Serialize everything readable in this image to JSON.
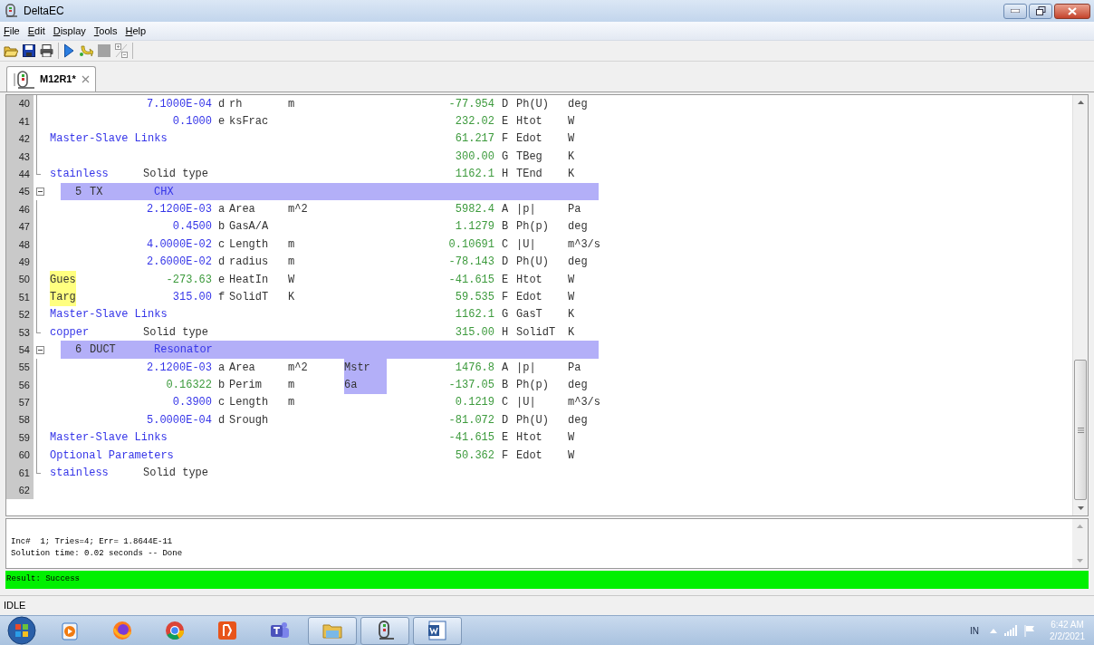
{
  "window": {
    "title": "DeltaEC"
  },
  "menu": [
    "File",
    "Edit",
    "Display",
    "Tools",
    "Help"
  ],
  "tabs": [
    {
      "label": "M12R1*",
      "selected": true
    }
  ],
  "editor": {
    "rows": [
      {
        "num": "40",
        "in_block": true,
        "param": {
          "value": "7.1000E-04",
          "letter": "d",
          "name": "rh",
          "unit": "m",
          "computed": false
        },
        "result": {
          "value": "-77.954",
          "letter": "D",
          "name": "Ph(U)",
          "unit": "deg"
        }
      },
      {
        "num": "41",
        "in_block": true,
        "param": {
          "value": "0.1000",
          "letter": "e",
          "name": "ksFrac",
          "computed": false
        },
        "result": {
          "value": "232.02",
          "letter": "E",
          "name": "Htot",
          "unit": "W"
        }
      },
      {
        "num": "42",
        "in_block": true,
        "label": {
          "text": "Master-Slave Links",
          "highlighted": false
        },
        "result": {
          "value": "61.217",
          "letter": "F",
          "name": "Edot",
          "unit": "W"
        }
      },
      {
        "num": "43",
        "in_block": true,
        "result": {
          "value": "300.00",
          "letter": "G",
          "name": "TBeg",
          "unit": "K"
        }
      },
      {
        "num": "44",
        "in_block": true,
        "block_end": true,
        "label": {
          "text": "stainless",
          "highlighted": false
        },
        "desc": "Solid type",
        "result": {
          "value": "1162.1",
          "letter": "H",
          "name": "TEnd",
          "unit": "K"
        }
      },
      {
        "num": "45",
        "header": {
          "number": "5",
          "type": "TX",
          "name": "CHX",
          "expanded": true
        }
      },
      {
        "num": "46",
        "in_block": true,
        "param": {
          "value": "2.1200E-03",
          "letter": "a",
          "name": "Area",
          "unit": "m^2",
          "computed": false
        },
        "result": {
          "value": "5982.4",
          "letter": "A",
          "name": "|p|",
          "unit": "Pa"
        }
      },
      {
        "num": "47",
        "in_block": true,
        "param": {
          "value": "0.4500",
          "letter": "b",
          "name": "GasA/A",
          "computed": false
        },
        "result": {
          "value": "1.1279",
          "letter": "B",
          "name": "Ph(p)",
          "unit": "deg"
        }
      },
      {
        "num": "48",
        "in_block": true,
        "param": {
          "value": "4.0000E-02",
          "letter": "c",
          "name": "Length",
          "unit": "m",
          "computed": false
        },
        "result": {
          "value": "0.10691",
          "letter": "C",
          "name": "|U|",
          "unit": "m^3/s"
        }
      },
      {
        "num": "49",
        "in_block": true,
        "param": {
          "value": "2.6000E-02",
          "letter": "d",
          "name": "radius",
          "unit": "m",
          "computed": false
        },
        "result": {
          "value": "-78.143",
          "letter": "D",
          "name": "Ph(U)",
          "unit": "deg"
        }
      },
      {
        "num": "50",
        "in_block": true,
        "label": {
          "text": "Gues",
          "highlighted": true
        },
        "param": {
          "value": "-273.63",
          "letter": "e",
          "name": "HeatIn",
          "unit": "W",
          "computed": true
        },
        "result": {
          "value": "-41.615",
          "letter": "E",
          "name": "Htot",
          "unit": "W"
        }
      },
      {
        "num": "51",
        "in_block": true,
        "label": {
          "text": "Targ",
          "highlighted": true
        },
        "param": {
          "value": "315.00",
          "letter": "f",
          "name": "SolidT",
          "unit": "K",
          "computed": false
        },
        "result": {
          "value": "59.535",
          "letter": "F",
          "name": "Edot",
          "unit": "W"
        }
      },
      {
        "num": "52",
        "in_block": true,
        "label": {
          "text": "Master-Slave Links",
          "highlighted": false
        },
        "result": {
          "value": "1162.1",
          "letter": "G",
          "name": "GasT",
          "unit": "K"
        }
      },
      {
        "num": "53",
        "in_block": true,
        "block_end": true,
        "label": {
          "text": "copper",
          "highlighted": false
        },
        "desc": "Solid type",
        "result": {
          "value": "315.00",
          "letter": "H",
          "name": "SolidT",
          "unit": "K"
        }
      },
      {
        "num": "54",
        "header": {
          "number": "6",
          "type": "DUCT",
          "name": "Resonator",
          "expanded": true
        }
      },
      {
        "num": "55",
        "in_block": true,
        "param": {
          "value": "2.1200E-03",
          "letter": "a",
          "name": "Area",
          "unit": "m^2",
          "computed": false
        },
        "note": "Mstr",
        "result": {
          "value": "1476.8",
          "letter": "A",
          "name": "|p|",
          "unit": "Pa"
        }
      },
      {
        "num": "56",
        "in_block": true,
        "param": {
          "value": "0.16322",
          "letter": "b",
          "name": "Perim",
          "unit": "m",
          "computed": true
        },
        "note": "6a",
        "result": {
          "value": "-137.05",
          "letter": "B",
          "name": "Ph(p)",
          "unit": "deg"
        }
      },
      {
        "num": "57",
        "in_block": true,
        "param": {
          "value": "0.3900",
          "letter": "c",
          "name": "Length",
          "unit": "m",
          "computed": false
        },
        "result": {
          "value": "0.1219",
          "letter": "C",
          "name": "|U|",
          "unit": "m^3/s"
        }
      },
      {
        "num": "58",
        "in_block": true,
        "param": {
          "value": "5.0000E-04",
          "letter": "d",
          "name": "Srough",
          "computed": false
        },
        "result": {
          "value": "-81.072",
          "letter": "D",
          "name": "Ph(U)",
          "unit": "deg"
        }
      },
      {
        "num": "59",
        "in_block": true,
        "label": {
          "text": "Master-Slave Links",
          "highlighted": false
        },
        "result": {
          "value": "-41.615",
          "letter": "E",
          "name": "Htot",
          "unit": "W"
        }
      },
      {
        "num": "60",
        "in_block": true,
        "label": {
          "text": "Optional Parameters",
          "highlighted": false
        },
        "result": {
          "value": "50.362",
          "letter": "F",
          "name": "Edot",
          "unit": "W"
        }
      },
      {
        "num": "61",
        "in_block": true,
        "block_end": true,
        "label": {
          "text": "stainless",
          "highlighted": false
        },
        "desc": "Solid type"
      },
      {
        "num": "62",
        "in_block": false
      }
    ]
  },
  "log": {
    "lines": [
      "Inc#  1; Tries=4; Err= 1.8644E-11",
      "Solution time: 0.02 seconds -- Done"
    ]
  },
  "result": {
    "text": "Result: Success",
    "kind": "success"
  },
  "status_bar": "IDLE",
  "taskbar": {
    "apps": [
      {
        "kind": "media",
        "running": false
      },
      {
        "kind": "firefox",
        "running": false
      },
      {
        "kind": "chrome",
        "running": false
      },
      {
        "kind": "pdf",
        "running": false
      },
      {
        "kind": "teams",
        "running": false
      },
      {
        "kind": "explorer",
        "running": true
      },
      {
        "kind": "deltaec",
        "running": true
      },
      {
        "kind": "word",
        "running": true
      }
    ],
    "tray": {
      "language": "IN",
      "time": "6:42 AM",
      "date": "2/2/2021"
    }
  }
}
